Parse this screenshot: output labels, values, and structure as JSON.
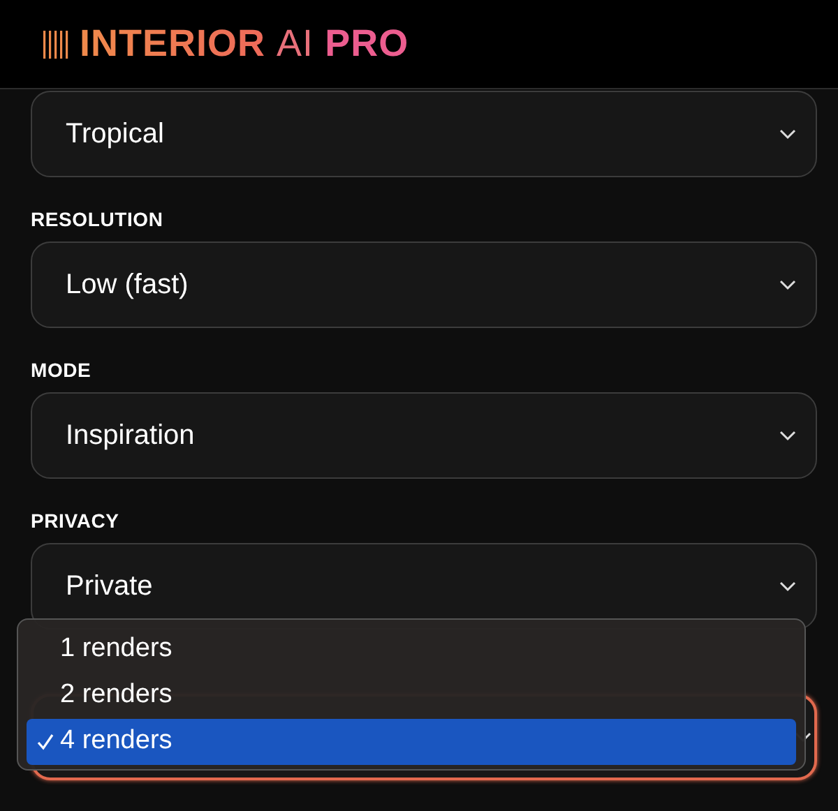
{
  "brand": {
    "name": "INTERIOR",
    "middle": "AI",
    "tier": "PRO"
  },
  "fields": [
    {
      "value": "Tropical",
      "focused": false
    },
    {
      "label": "RESOLUTION",
      "value": "Low (fast)",
      "focused": false
    },
    {
      "label": "MODE",
      "value": "Inspiration",
      "focused": false
    },
    {
      "label": "PRIVACY",
      "value": "Private",
      "focused": false
    },
    {
      "focused": true
    }
  ],
  "dropdown": {
    "options": [
      {
        "label": "1 renders",
        "selected": false
      },
      {
        "label": "2 renders",
        "selected": false
      },
      {
        "label": "4 renders",
        "selected": true
      }
    ]
  }
}
